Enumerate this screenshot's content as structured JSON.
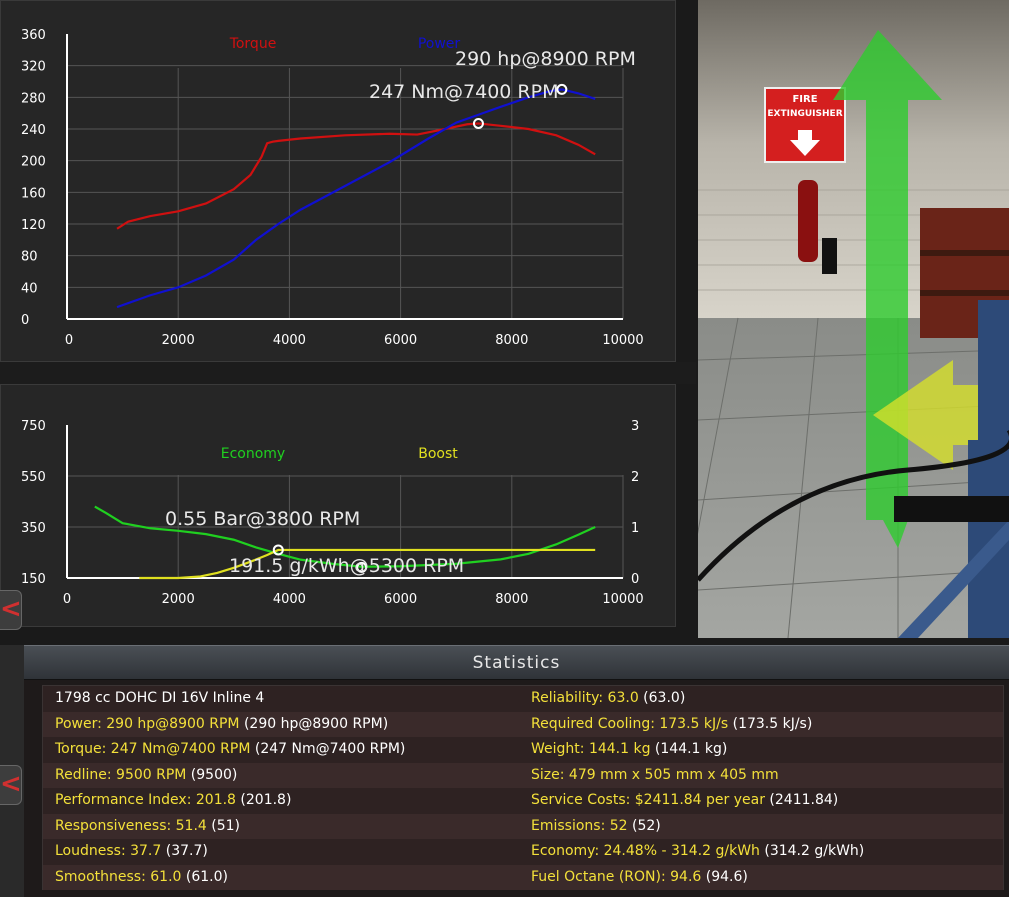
{
  "charts": [
    {
      "type": "line",
      "name": "power-torque",
      "legend": [
        "Torque",
        "Power"
      ],
      "legend_colors": [
        "#d01010",
        "#1010d0"
      ],
      "x_ticks": [
        "0",
        "2000",
        "4000",
        "6000",
        "8000",
        "10000"
      ],
      "y_ticks": [
        "0",
        "40",
        "80",
        "120",
        "160",
        "200",
        "240",
        "280",
        "320",
        "360"
      ],
      "xlim": [
        0,
        10000
      ],
      "ylim": [
        0,
        360
      ],
      "grid": true,
      "series": [
        {
          "name": "Torque",
          "color": "#d01010",
          "x": [
            900,
            1100,
            1500,
            2000,
            2500,
            3000,
            3300,
            3500,
            3600,
            3700,
            3800,
            4200,
            5000,
            5800,
            6300,
            6800,
            7200,
            7400,
            7800,
            8300,
            8800,
            9200,
            9500
          ],
          "y": [
            114,
            123,
            130,
            136,
            146,
            164,
            182,
            205,
            222,
            224,
            225,
            228,
            232,
            234,
            233,
            240,
            246,
            247,
            244,
            240,
            232,
            220,
            208
          ]
        },
        {
          "name": "Power",
          "color": "#1010d0",
          "x": [
            900,
            1500,
            2000,
            2500,
            3000,
            3400,
            3600,
            3800,
            4200,
            5000,
            5800,
            6500,
            7000,
            7400,
            7800,
            8300,
            8700,
            8900,
            9200,
            9500
          ],
          "y": [
            15,
            30,
            40,
            55,
            75,
            100,
            110,
            120,
            138,
            168,
            198,
            228,
            248,
            258,
            268,
            280,
            288,
            290,
            285,
            278
          ]
        }
      ],
      "markers": [
        {
          "x": 7400,
          "y": 247,
          "label": "247 Nm@7400 RPM"
        },
        {
          "x": 8900,
          "y": 290,
          "label": "290 hp@8900 RPM"
        }
      ]
    },
    {
      "type": "line",
      "name": "economy-boost",
      "legend": [
        "Economy",
        "Boost"
      ],
      "legend_colors": [
        "#20d020",
        "#e0e020"
      ],
      "x_ticks": [
        "0",
        "2000",
        "4000",
        "6000",
        "8000",
        "10000"
      ],
      "y_ticks_left": [
        "150",
        "350",
        "550",
        "750"
      ],
      "y_ticks_right": [
        "0",
        "1",
        "2",
        "3"
      ],
      "xlim": [
        0,
        10000
      ],
      "ylim_left": [
        150,
        750
      ],
      "ylim_right": [
        0,
        3
      ],
      "grid": true,
      "series": [
        {
          "name": "Economy",
          "axis": "left",
          "color": "#20d020",
          "x": [
            500,
            700,
            1000,
            1500,
            2000,
            2500,
            3000,
            3400,
            3800,
            4200,
            4800,
            5300,
            6000,
            7000,
            7800,
            8300,
            8800,
            9200,
            9500
          ],
          "y": [
            430,
            405,
            365,
            345,
            335,
            322,
            300,
            270,
            245,
            222,
            205,
            194,
            196,
            206,
            223,
            245,
            282,
            320,
            350
          ]
        },
        {
          "name": "Boost",
          "axis": "right",
          "color": "#e0e020",
          "x": [
            1300,
            2000,
            2400,
            2700,
            3000,
            3300,
            3600,
            3800,
            4200,
            5000,
            6000,
            7000,
            8000,
            9000,
            9500
          ],
          "y": [
            0,
            0,
            0.03,
            0.1,
            0.2,
            0.32,
            0.45,
            0.55,
            0.55,
            0.55,
            0.55,
            0.55,
            0.55,
            0.55,
            0.55
          ]
        }
      ],
      "markers": [
        {
          "axis": "right",
          "x": 3800,
          "y": 0.55,
          "label": "0.55 Bar@3800 RPM"
        },
        {
          "axis": "left",
          "x": 5300,
          "y": 191.5,
          "label": "191.5 g/kWh@5300 RPM"
        }
      ]
    }
  ],
  "scene": {
    "sign_line1": "FIRE",
    "sign_line2": "EXTINGUISHER"
  },
  "side_tabs": {
    "tab1_icon": "<",
    "tab2_icon": "<"
  },
  "statistics": {
    "title": "Statistics",
    "left": [
      {
        "a": "1798 cc DOHC DI 16V Inline 4",
        "b": ""
      },
      {
        "a": "Power: 290 hp@8900 RPM",
        "b": "(290 hp@8900 RPM)"
      },
      {
        "a": "Torque: 247 Nm@7400 RPM",
        "b": "(247 Nm@7400 RPM)"
      },
      {
        "a": "Redline: 9500 RPM",
        "b": "(9500)"
      },
      {
        "a": "Performance Index: 201.8",
        "b": "(201.8)"
      },
      {
        "a": "Responsiveness: 51.4",
        "b": "(51)"
      },
      {
        "a": "Loudness: 37.7",
        "b": "(37.7)"
      },
      {
        "a": "Smoothness: 61.0",
        "b": "(61.0)"
      }
    ],
    "right": [
      {
        "a": "Reliability: 63.0",
        "b": "(63.0)"
      },
      {
        "a": "Required Cooling: 173.5 kJ/s",
        "b": "(173.5 kJ/s)"
      },
      {
        "a": "Weight: 144.1 kg",
        "b": "(144.1 kg)"
      },
      {
        "a": "Size: 479 mm x 505 mm x 405 mm",
        "b": ""
      },
      {
        "a": "Service Costs: $2411.84 per year",
        "b": "(2411.84)"
      },
      {
        "a": "Emissions: 52",
        "b": "(52)"
      },
      {
        "a": "Economy: 24.48% - 314.2 g/kWh",
        "b": "(314.2 g/kWh)"
      },
      {
        "a": "Fuel Octane (RON): 94.6",
        "b": "(94.6)"
      }
    ]
  }
}
